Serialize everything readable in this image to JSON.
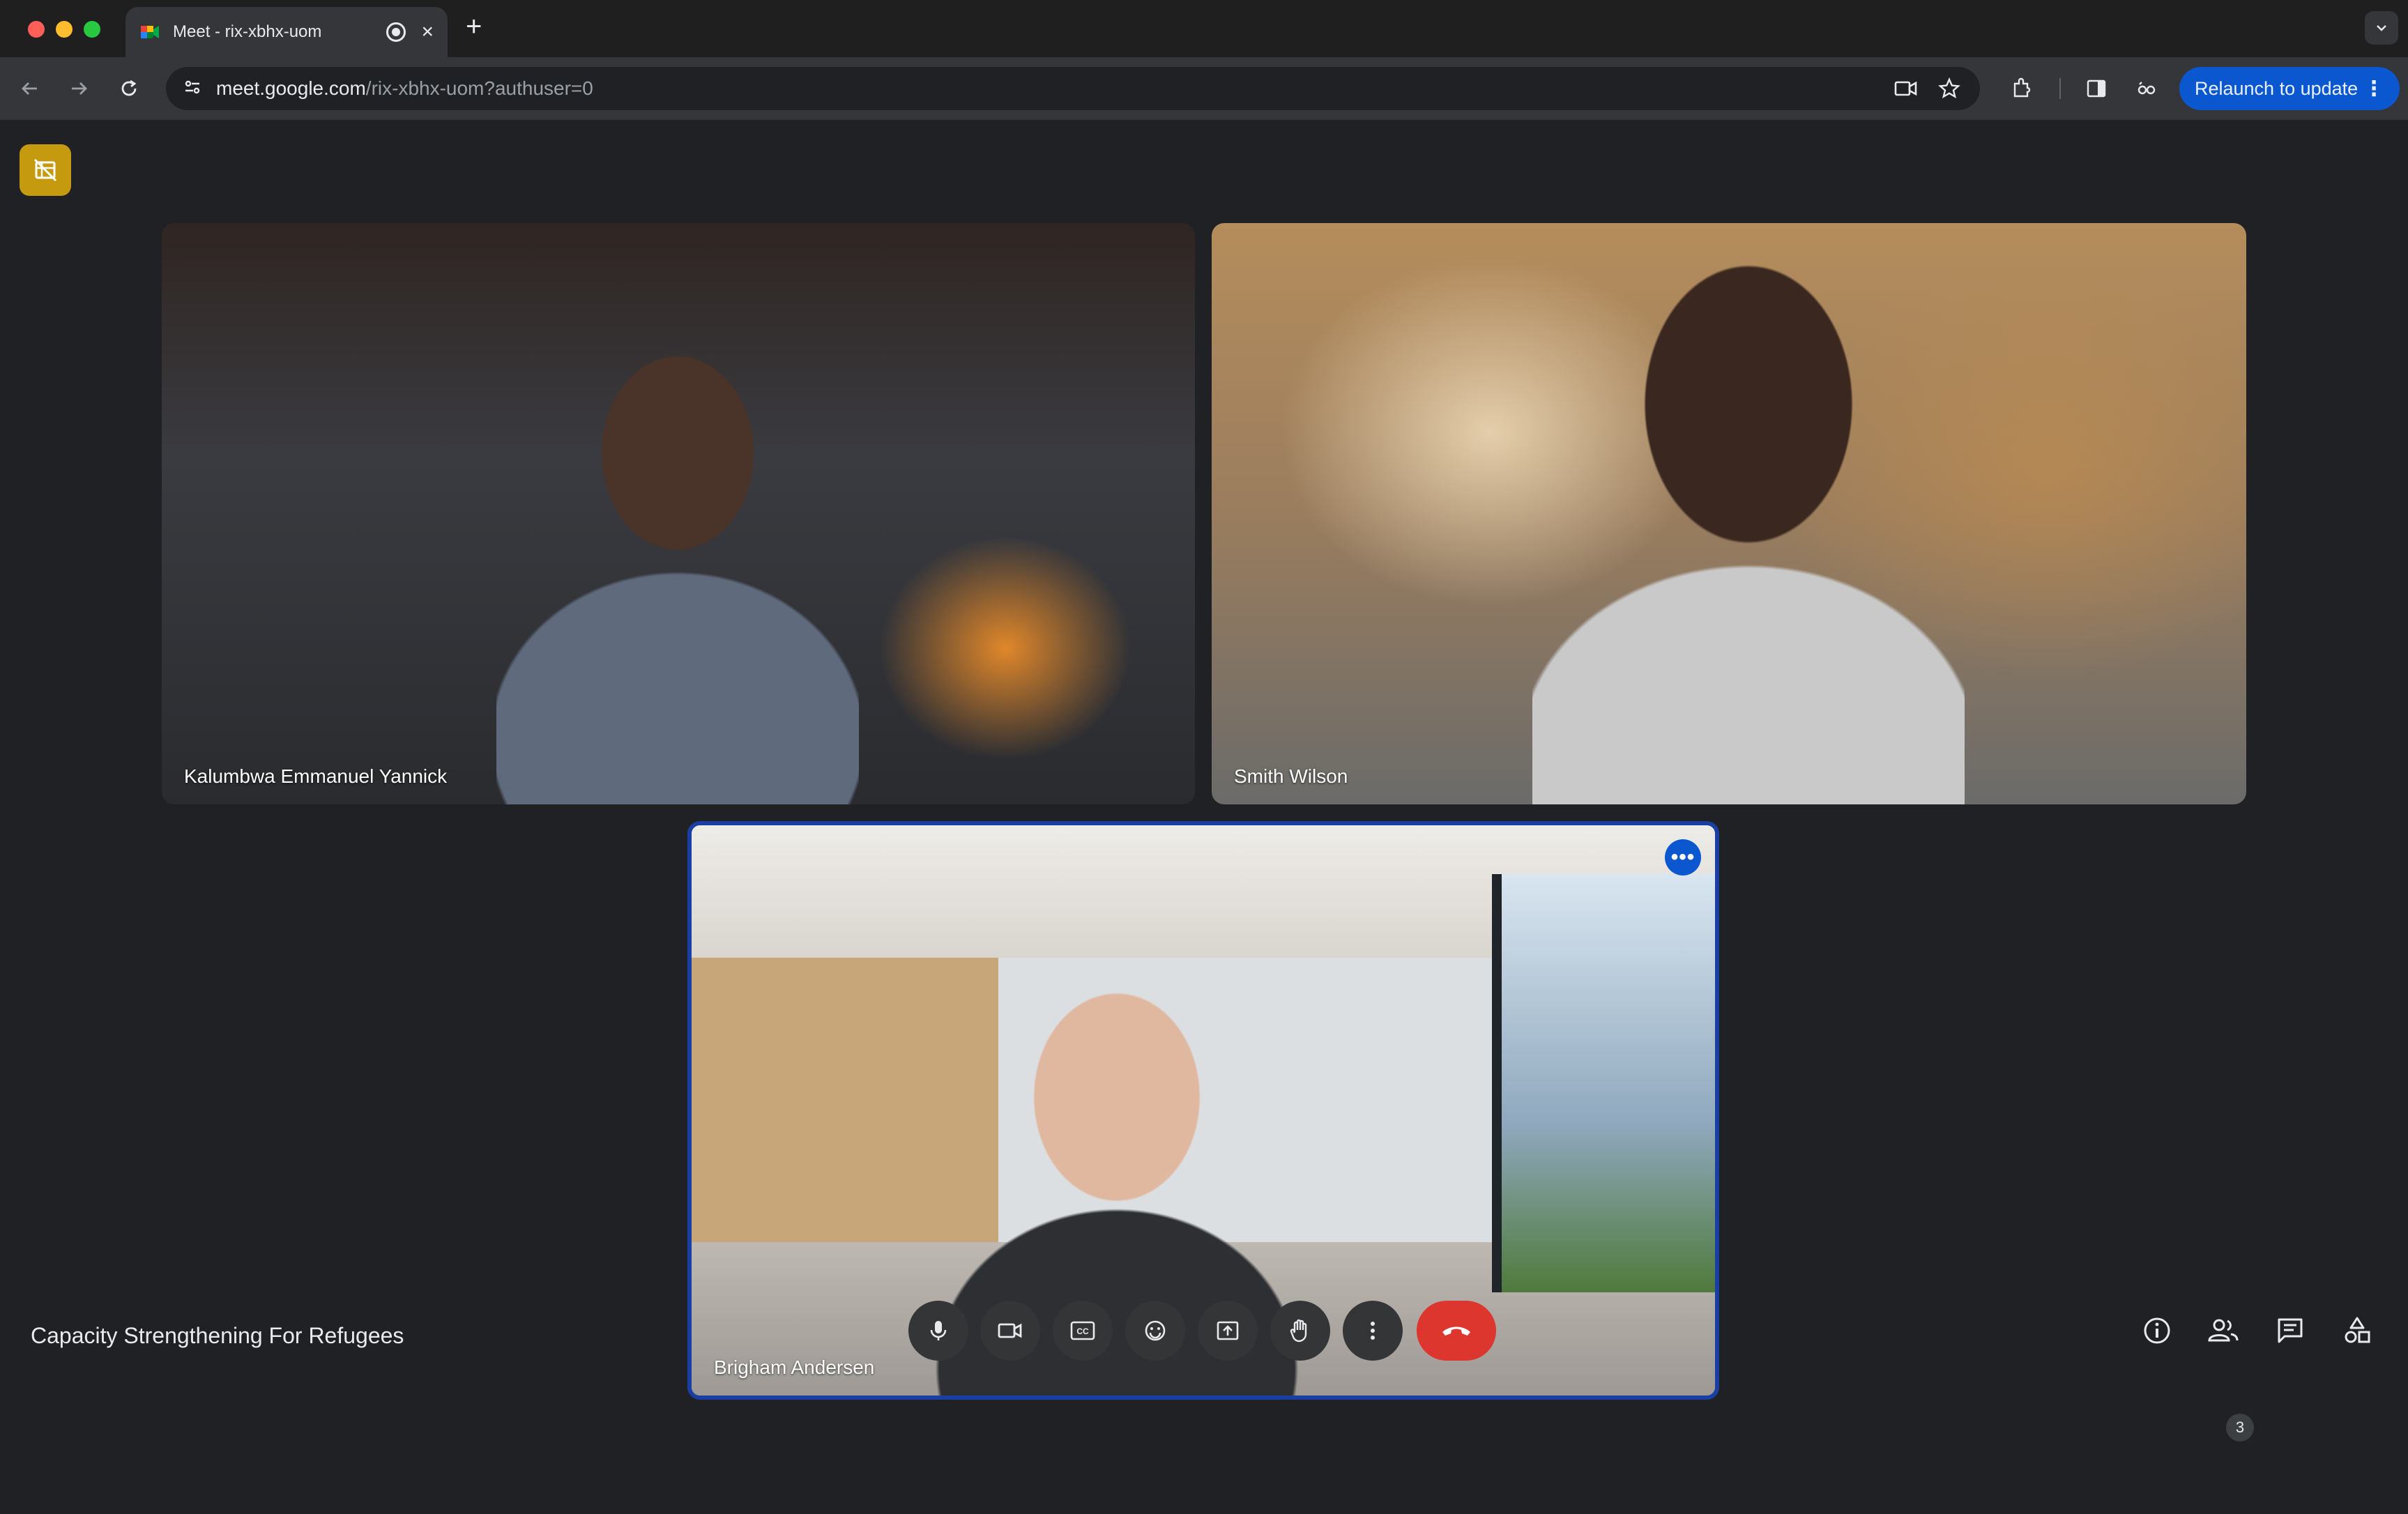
{
  "browser": {
    "tab_title": "Meet - rix-xbhx-uom",
    "url_host": "meet.google.com",
    "url_path": "/rix-xbhx-uom?authuser=0",
    "relaunch_label": "Relaunch to update"
  },
  "tiles": [
    {
      "name": "Kalumbwa Emmanuel Yannick"
    },
    {
      "name": "Smith Wilson"
    },
    {
      "name": "Brigham Andersen"
    }
  ],
  "meeting": {
    "title": "Capacity Strengthening For Refugees",
    "participant_count": "3"
  },
  "controls": [
    "mic",
    "camera",
    "captions",
    "emoji",
    "present",
    "raise-hand",
    "more",
    "leave-call"
  ],
  "colors": {
    "background": "#202124",
    "accent": "#0b57d0",
    "hangup": "#dc362e",
    "badge": "#c59a0e"
  }
}
